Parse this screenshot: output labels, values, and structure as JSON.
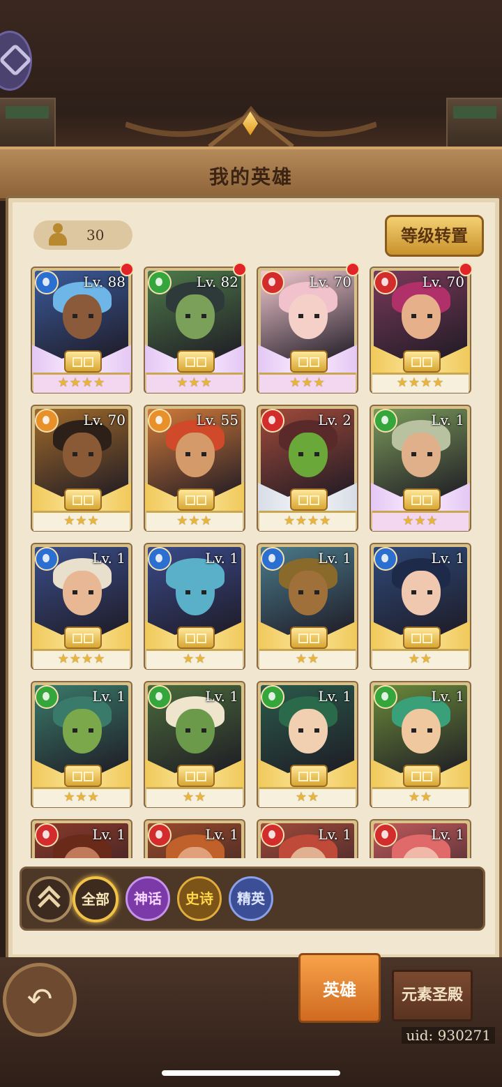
{
  "header": {
    "title": "我的英雄"
  },
  "hero_count": "30",
  "level_transfer_label": "等级转置",
  "heroes": [
    {
      "level": "Lv. 88",
      "element": "water",
      "stars": "★★★★",
      "red_dot": true,
      "rarity": "mythic",
      "skin": "#8a5a3a",
      "hair": "#6fb6e8",
      "bg": "#3b5a9a"
    },
    {
      "level": "Lv. 82",
      "element": "nature",
      "stars": "★★★",
      "red_dot": true,
      "rarity": "mythic",
      "skin": "#7aa05a",
      "hair": "#2e3a3a",
      "bg": "#4e7a4a"
    },
    {
      "level": "Lv. 70",
      "element": "fire",
      "stars": "★★★",
      "red_dot": true,
      "rarity": "mythic",
      "skin": "#f4d0c8",
      "hair": "#f2c2cc",
      "bg": "#f1c8cf"
    },
    {
      "level": "Lv. 70",
      "element": "fire",
      "stars": "★★★★",
      "red_dot": true,
      "rarity": "legend",
      "skin": "#e6b08a",
      "hair": "#b0306a",
      "bg": "#7a3a5a"
    },
    {
      "level": "Lv. 70",
      "element": "light",
      "stars": "★★★",
      "red_dot": false,
      "rarity": "legend",
      "skin": "#8a5a36",
      "hair": "#2c2018",
      "bg": "#a06a2a"
    },
    {
      "level": "Lv. 55",
      "element": "light",
      "stars": "★★★",
      "red_dot": false,
      "rarity": "legend",
      "skin": "#d49a6a",
      "hair": "#d04a2a",
      "bg": "#d07a3a"
    },
    {
      "level": "Lv. 2",
      "element": "fire",
      "stars": "★★★★",
      "red_dot": false,
      "rarity": "silver",
      "skin": "#6aa83a",
      "hair": "#5a2a2a",
      "bg": "#a04a3a"
    },
    {
      "level": "Lv. 1",
      "element": "nature",
      "stars": "★★★",
      "red_dot": false,
      "rarity": "mythic",
      "skin": "#e0b08a",
      "hair": "#b8c2a0",
      "bg": "#7a9a5a"
    },
    {
      "level": "Lv. 1",
      "element": "water",
      "stars": "★★★★",
      "red_dot": false,
      "rarity": "legend",
      "skin": "#e8b894",
      "hair": "#e8e0cc",
      "bg": "#3a4e8a"
    },
    {
      "level": "Lv. 1",
      "element": "water",
      "stars": "★★",
      "red_dot": false,
      "rarity": "legend",
      "skin": "#5ab0c8",
      "hair": "#5ab0c8",
      "bg": "#3a4a8a"
    },
    {
      "level": "Lv. 1",
      "element": "water",
      "stars": "★★",
      "red_dot": false,
      "rarity": "legend",
      "skin": "#a0703a",
      "hair": "#8a6a2a",
      "bg": "#4a7a8a"
    },
    {
      "level": "Lv. 1",
      "element": "water",
      "stars": "★★",
      "red_dot": false,
      "rarity": "legend",
      "skin": "#f0c8b0",
      "hair": "#1e2a4a",
      "bg": "#2e4a7a"
    },
    {
      "level": "Lv. 1",
      "element": "nature",
      "stars": "★★★",
      "red_dot": false,
      "rarity": "legend",
      "skin": "#7aa84a",
      "hair": "#3a7a6a",
      "bg": "#3a7a6a"
    },
    {
      "level": "Lv. 1",
      "element": "nature",
      "stars": "★★",
      "red_dot": false,
      "rarity": "legend",
      "skin": "#6a9a4a",
      "hair": "#efe4cc",
      "bg": "#4a6a3a"
    },
    {
      "level": "Lv. 1",
      "element": "nature",
      "stars": "★★",
      "red_dot": false,
      "rarity": "legend",
      "skin": "#f0d0b0",
      "hair": "#2a6a4a",
      "bg": "#2a5a4a"
    },
    {
      "level": "Lv. 1",
      "element": "nature",
      "stars": "★★",
      "red_dot": false,
      "rarity": "legend",
      "skin": "#f0c8a0",
      "hair": "#3aa07a",
      "bg": "#6a8a3a"
    },
    {
      "level": "Lv. 1",
      "element": "fire",
      "stars": "",
      "red_dot": false,
      "rarity": "legend",
      "skin": "#c07a5a",
      "hair": "#6a2a1a",
      "bg": "#8a3a2a"
    },
    {
      "level": "Lv. 1",
      "element": "fire",
      "stars": "",
      "red_dot": false,
      "rarity": "legend",
      "skin": "#e0a07a",
      "hair": "#c0602a",
      "bg": "#9a4a2a"
    },
    {
      "level": "Lv. 1",
      "element": "fire",
      "stars": "",
      "red_dot": false,
      "rarity": "legend",
      "skin": "#e0b090",
      "hair": "#c04a3a",
      "bg": "#a04a3a"
    },
    {
      "level": "Lv. 1",
      "element": "fire",
      "stars": "",
      "red_dot": false,
      "rarity": "legend",
      "skin": "#f0b8a8",
      "hair": "#e06a6a",
      "bg": "#c05a5a"
    }
  ],
  "filters": [
    {
      "label": "全部",
      "name": "filter-all-button"
    },
    {
      "label": "神话",
      "name": "filter-mythic-button"
    },
    {
      "label": "史诗",
      "name": "filter-epic-button"
    },
    {
      "label": "精英",
      "name": "filter-elite-button"
    }
  ],
  "tabs": {
    "hero": "英雄",
    "temple": "元素圣殿"
  },
  "uid": "uid: 930271",
  "colors": {
    "panel": "#f1e6cf",
    "accent_gold": "#f0c247",
    "tab_active": "#e2832e"
  }
}
